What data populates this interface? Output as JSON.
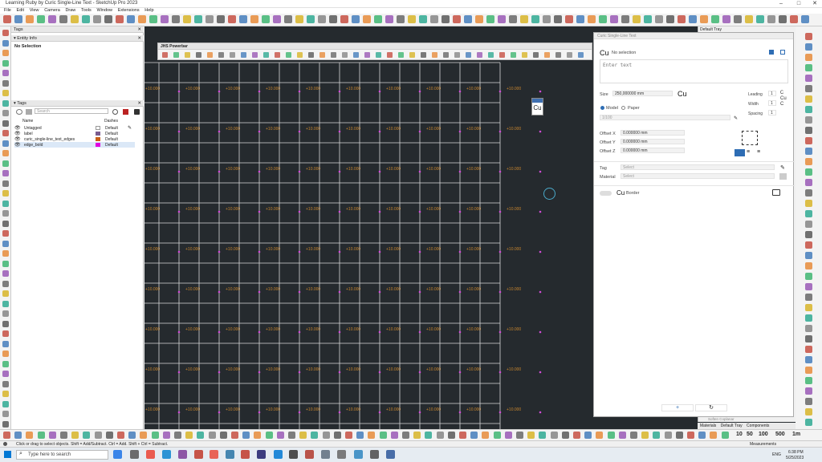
{
  "window": {
    "title": "Learning Ruby by Curic Single-Line Text - SketchUp Pro 2023"
  },
  "menu": [
    "File",
    "Edit",
    "View",
    "Camera",
    "Draw",
    "Tools",
    "Window",
    "Extensions",
    "Help"
  ],
  "panels": {
    "tags_header": "Tags",
    "entity_info": {
      "title": "Entity Info",
      "selection": "No Selection"
    },
    "tags": {
      "title": "Tags",
      "search_placeholder": "Search",
      "col_name": "Name",
      "col_dashes": "Dashes",
      "rows": [
        {
          "name": "Untagged",
          "color": "#ffffff",
          "dashes": "Default"
        },
        {
          "name": "label",
          "color": "#7a5c8f",
          "dashes": "Default"
        },
        {
          "name": "curic_single-line_text_edges",
          "color": "#c95e16",
          "dashes": "Default"
        },
        {
          "name": "edge_bold",
          "color": "#e000e0",
          "dashes": "Default"
        }
      ]
    }
  },
  "powerbar": {
    "title": "JHS Powerbar"
  },
  "viewport": {
    "grid_label": "+10.000",
    "mini_label": "Cu"
  },
  "curic": {
    "title": "Curic Single-Line Text",
    "logo": "Cu",
    "selection": "No selection",
    "enter_text_placeholder": "Enter text",
    "size_label": "Size",
    "size_value": "250,000000 mm",
    "size_preview": "Cu",
    "leading_label": "Leading",
    "leading_value": "1",
    "width_label": "Width",
    "width_value": "1",
    "spacing_label": "Spacing",
    "spacing_value": "1",
    "model_label": "Model",
    "paper_label": "Paper",
    "scale_value": "1/100",
    "offset_x_label": "Offset X",
    "offset_x_value": "0.000000 mm",
    "offset_y_label": "Offset Y",
    "offset_y_value": "0.000000 mm",
    "offset_z_label": "Offset Z",
    "offset_z_value": "0.000000 mm",
    "tag_label": "Tag",
    "tag_value": "Select",
    "material_label": "Material",
    "material_value": "Select",
    "border_label": "Border",
    "border_icon": "Cu",
    "add_label": "+",
    "refresh_label": "↻"
  },
  "tray": {
    "title": "Default Tray",
    "hint": "Soften Coplanar",
    "tabs": [
      "Materials",
      "Default Tray",
      "Components"
    ]
  },
  "bottom_toolbar_numbers": [
    "10",
    "50",
    "100",
    "500",
    "1m"
  ],
  "status": {
    "hint": "Click or drag to select objects. Shift = Add/Subtract. Ctrl = Add. Shift + Ctrl = Subtract.",
    "measurements_label": "Measurements"
  },
  "taskbar": {
    "search": "Type here to search",
    "lang": "ENG",
    "time": "6:38 PM",
    "date": "5/25/2023"
  }
}
